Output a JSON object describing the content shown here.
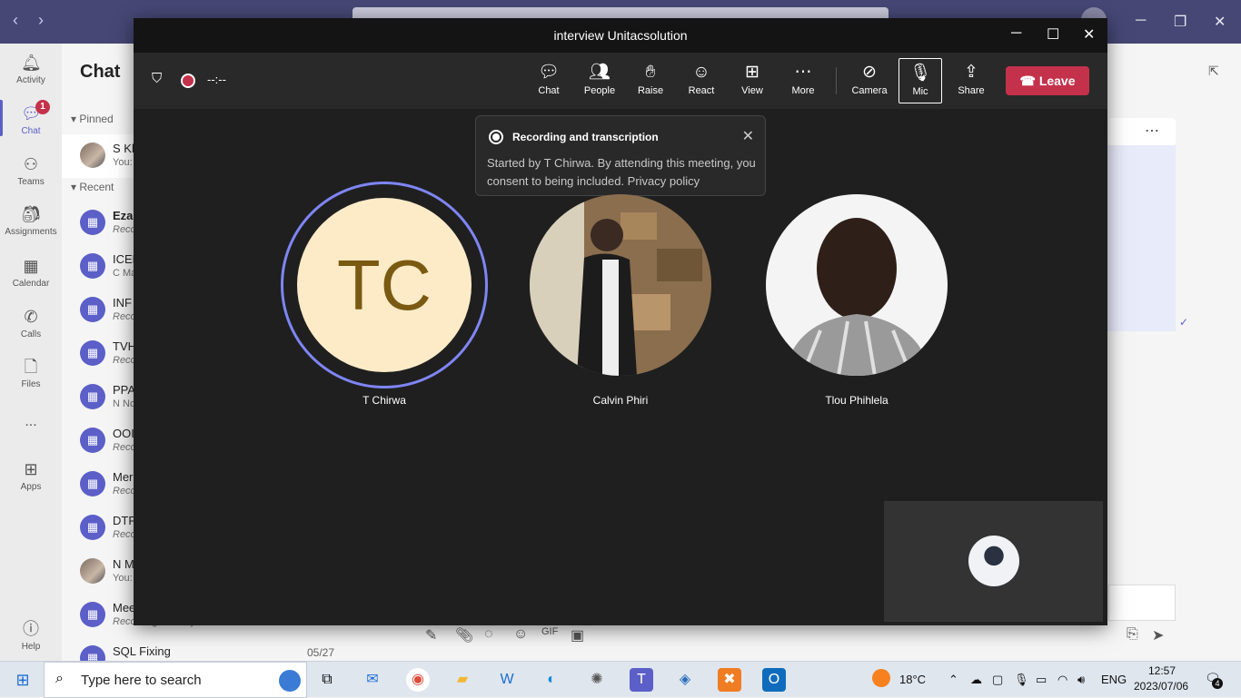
{
  "teams": {
    "nav_back": "‹",
    "nav_fwd": "›",
    "rail": [
      {
        "label": "Activity",
        "icon": "bell-icon"
      },
      {
        "label": "Chat",
        "icon": "chat-icon",
        "badge": "1"
      },
      {
        "label": "Teams",
        "icon": "teams-icon"
      },
      {
        "label": "Assignments",
        "icon": "assignments-icon"
      },
      {
        "label": "Calendar",
        "icon": "calendar-icon"
      },
      {
        "label": "Calls",
        "icon": "phone-icon"
      },
      {
        "label": "Files",
        "icon": "file-icon"
      },
      {
        "label": "...",
        "icon": "more-icon"
      },
      {
        "label": "Apps",
        "icon": "apps-icon"
      },
      {
        "label": "Help",
        "icon": "help-icon"
      }
    ],
    "chat_heading": "Chat",
    "pinned_label": "Pinned",
    "recent_label": "Recent",
    "pinned": [
      {
        "name": "S Kh",
        "sub": "You:"
      }
    ],
    "recent": [
      {
        "name": "Eza",
        "sub": "Reco"
      },
      {
        "name": "ICEF",
        "sub": "C Ma"
      },
      {
        "name": "INF",
        "sub": "Reco"
      },
      {
        "name": "TVH",
        "sub": "Reco"
      },
      {
        "name": "PPA",
        "sub": "N Nc"
      },
      {
        "name": "OOI",
        "sub": "Reco"
      },
      {
        "name": "Mer",
        "sub": "Reco"
      },
      {
        "name": "DTP",
        "sub": "Reco"
      },
      {
        "name": "N M",
        "sub": "You:"
      },
      {
        "name": "Mee",
        "sub": "Recording is ready"
      },
      {
        "name": "SQL Fixing",
        "sub": "",
        "date": "05/27"
      }
    ]
  },
  "meeting": {
    "title": "interview Unitacsolution",
    "timer": "--:--",
    "toolbar": [
      {
        "label": "Chat",
        "icon": "chat-bubble-icon"
      },
      {
        "label": "People",
        "icon": "people-icon"
      },
      {
        "label": "Raise",
        "icon": "hand-icon"
      },
      {
        "label": "React",
        "icon": "smile-icon"
      },
      {
        "label": "View",
        "icon": "grid-icon"
      },
      {
        "label": "More",
        "icon": "more-icon"
      },
      {
        "label": "Camera",
        "icon": "camera-off-icon"
      },
      {
        "label": "Mic",
        "icon": "mic-icon"
      },
      {
        "label": "Share",
        "icon": "share-icon"
      }
    ],
    "leave_label": "Leave",
    "toast": {
      "title": "Recording and transcription",
      "body": "Started by T Chirwa. By attending this meeting, you consent to being included. Privacy policy"
    },
    "participants": [
      {
        "name": "T Chirwa",
        "initials": "TC"
      },
      {
        "name": "Calvin Phiri"
      },
      {
        "name": "Tlou Phihlela"
      }
    ]
  },
  "taskbar": {
    "search_placeholder": "Type here to search",
    "weather": "18°C",
    "lang": "ENG",
    "time": "12:57",
    "date": "2023/07/06",
    "notif_count": "4"
  },
  "colors": {
    "accent": "#5b5fc7",
    "leave": "#c4314b",
    "meeting_bg": "#1f1f1f",
    "tc_fill": "#fdebc8",
    "tc_text": "#7a5a12"
  }
}
